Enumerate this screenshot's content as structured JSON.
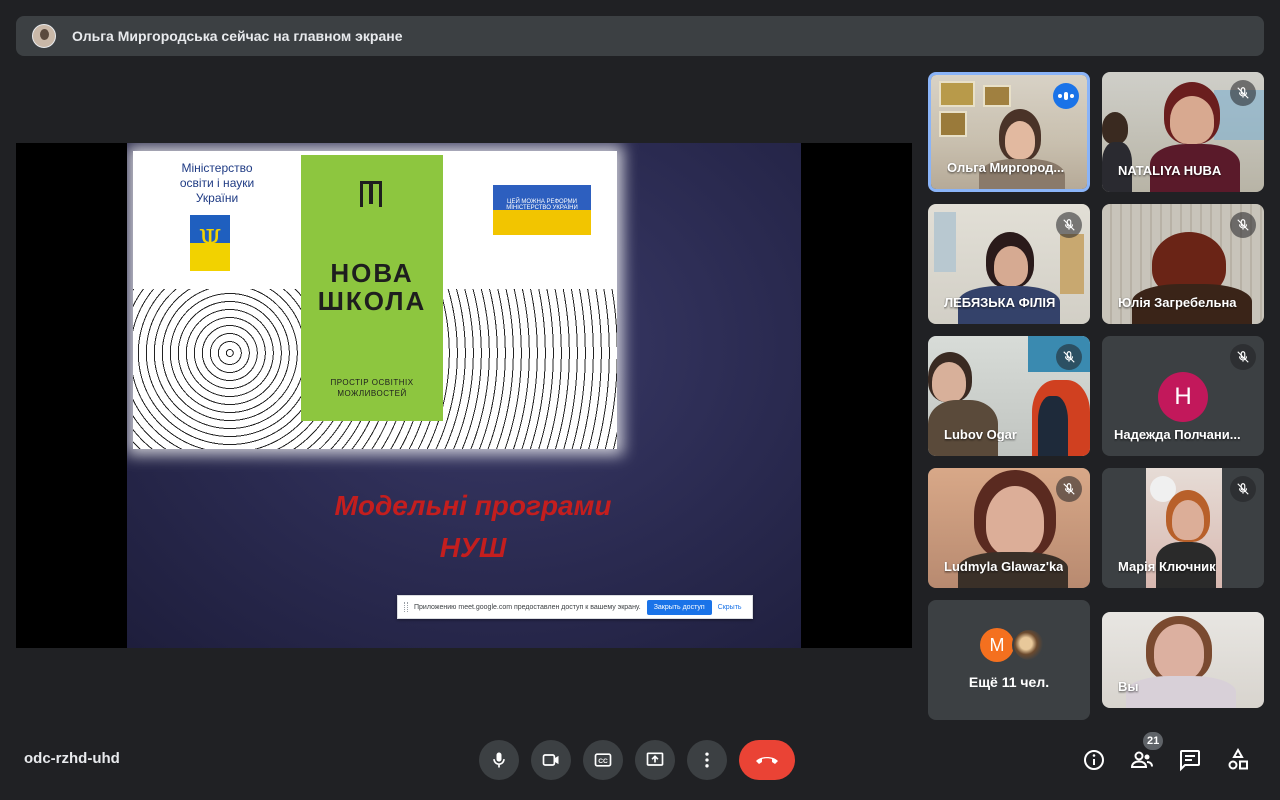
{
  "banner": {
    "text": "Ольга Миргородська сейчас на главном экране",
    "icon": "presenter-avatar"
  },
  "presentation": {
    "ministry_text": "Міністерство освіти і науки України",
    "nova_title": "НОВА ШКОЛА",
    "nova_subtitle": "ПРОСТІР ОСВІТНІХ МОЖЛИВОСТЕЙ",
    "reform_badge": "ЦЕЙ МОЖНА РЕФОРМИ МІНІСТЕРСТВО УКРАЇНИ",
    "title_line1": "Модельні програми",
    "title_line2": "НУШ",
    "title_color": "#c41e1e"
  },
  "share_bar": {
    "message": "Приложению meet.google.com предоставлен доступ к вашему экрану.",
    "stop_label": "Закрыть доступ",
    "hide_label": "Скрыть"
  },
  "participants": [
    {
      "name": "Ольга Миргород...",
      "status": "speaking"
    },
    {
      "name": "NATALIYA HUBA",
      "status": "muted"
    },
    {
      "name": "ЛЕБЯЗЬКА ФІЛІЯ",
      "status": "muted"
    },
    {
      "name": "Юлія Загребельна",
      "status": "muted"
    },
    {
      "name": "Lubov Ogar",
      "status": "muted"
    },
    {
      "name": "Надежда Полчани...",
      "status": "muted",
      "initial": "Н",
      "avatar_color": "#c2185b"
    },
    {
      "name": "Ludmyla Glawaz'ka",
      "status": "muted"
    },
    {
      "name": "Марія Ключник",
      "status": "muted"
    },
    {
      "more_label": "Ещё 11 чел.",
      "initial": "М",
      "avatar_color": "#f4701f"
    },
    {
      "name": "Вы",
      "status": "self"
    }
  ],
  "bottom": {
    "meeting_code": "odc-rzhd-uhd",
    "controls": [
      "mic-icon",
      "camera-icon",
      "captions-icon",
      "present-icon",
      "more-options-icon",
      "end-call-icon"
    ],
    "right_controls": [
      "info-icon",
      "people-icon",
      "chat-icon",
      "activities-icon"
    ],
    "participant_count": "21",
    "end_call_color": "#ea4335"
  }
}
